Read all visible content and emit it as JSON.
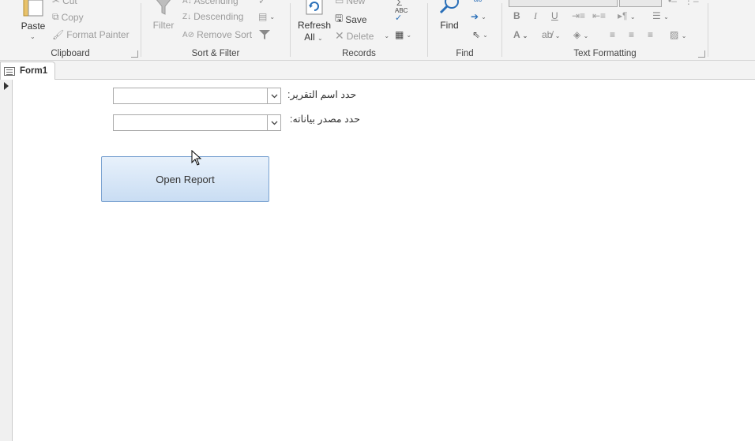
{
  "ribbon": {
    "clipboard": {
      "label": "Clipboard",
      "paste": "Paste",
      "cut": "Cut",
      "copy": "Copy",
      "format_painter": "Format Painter"
    },
    "sort_filter": {
      "label": "Sort & Filter",
      "filter": "Filter",
      "ascending": "Ascending",
      "descending": "Descending",
      "remove_sort": "Remove Sort"
    },
    "records": {
      "label": "Records",
      "refresh": "Refresh",
      "refresh_all": "All",
      "new": "New",
      "save": "Save",
      "delete": "Delete"
    },
    "find": {
      "label": "Find",
      "find": "Find"
    },
    "text_formatting": {
      "label": "Text Formatting",
      "bold": "B",
      "italic": "I",
      "underline": "U",
      "font_color": "A"
    }
  },
  "tabs": [
    {
      "label": "Form1"
    }
  ],
  "form": {
    "report_name_label": "حدد اسم التقرير:",
    "report_name_value": "",
    "data_source_label": "حدد مصدر بياناته:",
    "data_source_value": "",
    "open_report_button": "Open Report"
  }
}
